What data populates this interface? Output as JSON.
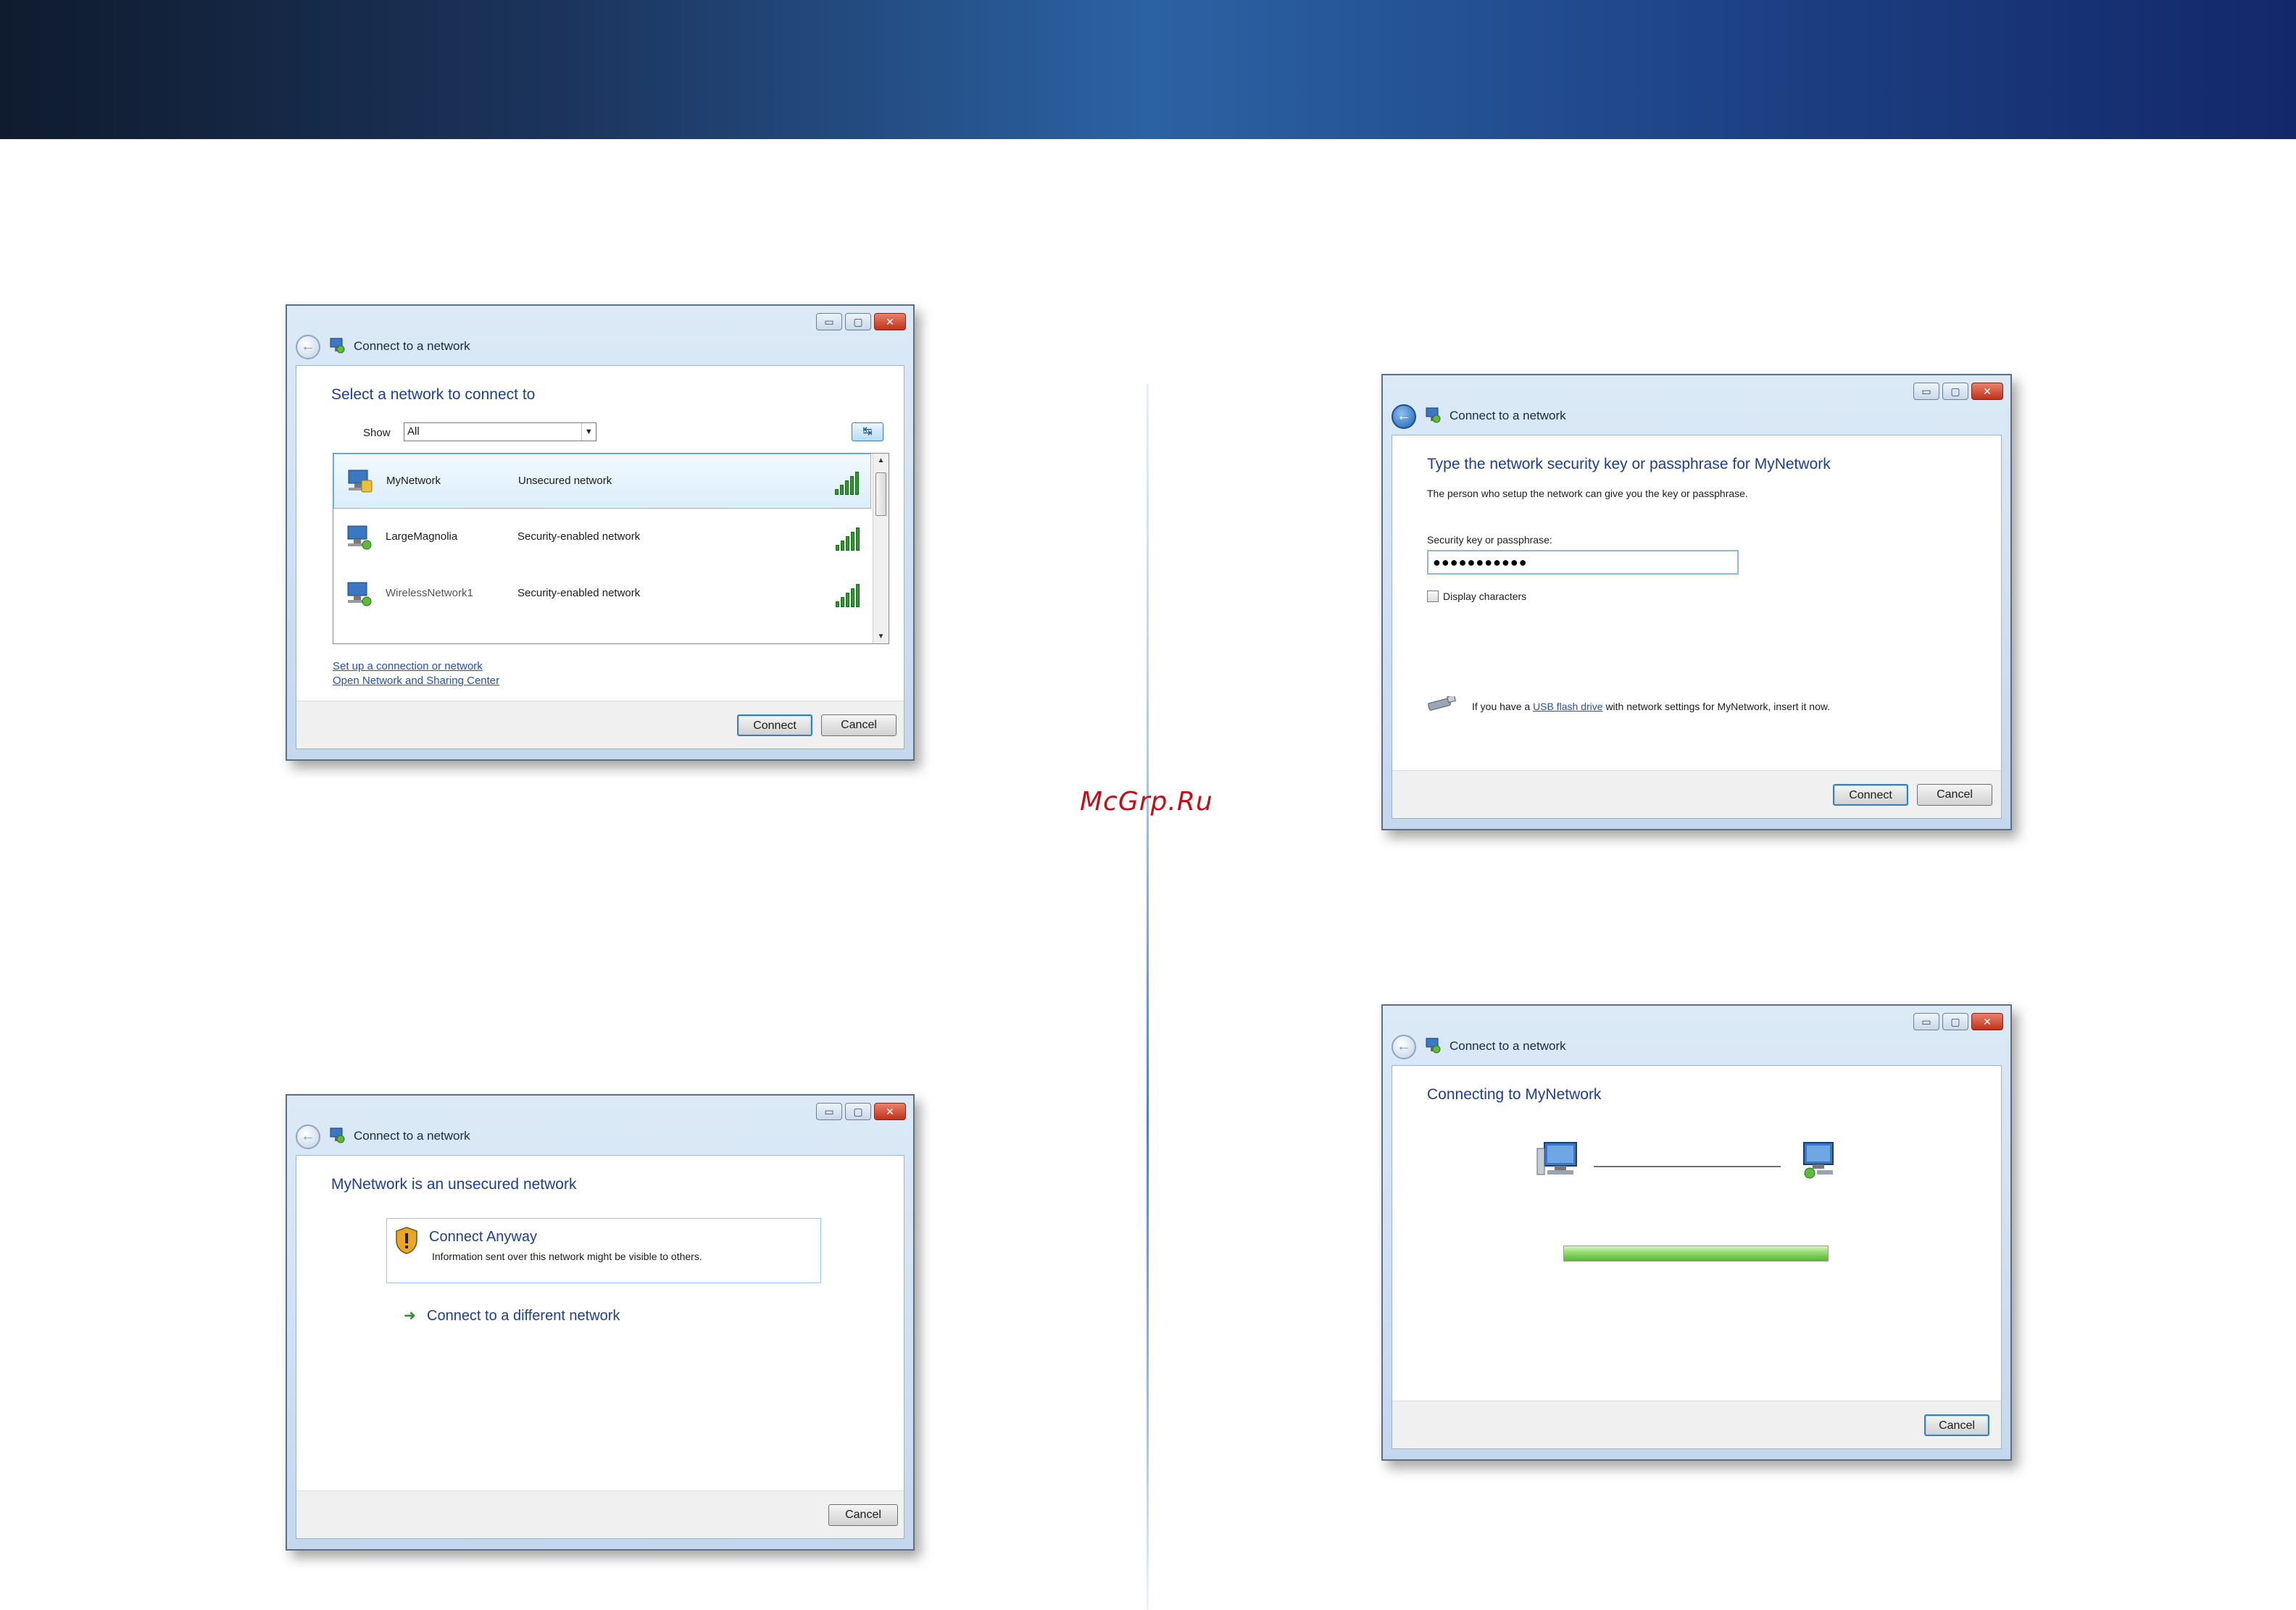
{
  "watermark": "McGrp.Ru",
  "caption_buttons": {
    "minimize": "▭",
    "maximize": "▢",
    "close": "✕"
  },
  "icons": {
    "back": "back-arrow-icon",
    "title_network": "network-icon",
    "refresh": "refresh-icon",
    "network": "network-connection-icon",
    "signal": "signal-strength-icon",
    "usb": "usb-drive-icon",
    "shield": "security-shield-icon",
    "arrow": "green-arrow-icon",
    "computer": "computer-icon"
  },
  "colors": {
    "heading": "#1e3e8f",
    "link": "#2450b0",
    "signal": "#2e9a2e",
    "watermark": "#c0101a"
  },
  "window_select": {
    "title": "Connect to a network",
    "heading": "Select a network to connect to",
    "show_label": "Show",
    "show_value": "All",
    "refresh_glyph": "↹",
    "networks": [
      {
        "name": "MyNetwork",
        "security": "Unsecured network",
        "selected": true,
        "signal": 5
      },
      {
        "name": "LargeMagnolia",
        "security": "Security-enabled network",
        "selected": false,
        "signal": 5
      },
      {
        "name": "WirelessNetwork1",
        "security": "Security-enabled network",
        "selected": false,
        "signal": 5
      }
    ],
    "links": [
      "Set up a connection or network",
      "Open Network and Sharing Center"
    ],
    "connect_label": "Connect",
    "cancel_label": "Cancel"
  },
  "window_key": {
    "title": "Connect to a network",
    "heading": "Type the network security key or passphrase for MyNetwork",
    "subtext": "The person who setup the network can give you the key or passphrase.",
    "field_label": "Security key or passphrase:",
    "field_value": "●●●●●●●●●●●",
    "display_chars_label": "Display characters",
    "display_chars_checked": false,
    "usb_text_before": "If you have a",
    "usb_link": "USB flash drive",
    "usb_text_after": "with network settings for MyNetwork, insert it now.",
    "connect_label": "Connect",
    "cancel_label": "Cancel"
  },
  "window_unsecured": {
    "title": "Connect to a network",
    "heading": "MyNetwork is an unsecured network",
    "option_title": "Connect Anyway",
    "option_desc": "Information sent over this network might be visible to others.",
    "alt_option": "Connect to a different network",
    "cancel_label": "Cancel"
  },
  "window_connecting": {
    "title": "Connect to a network",
    "heading": "Connecting to MyNetwork",
    "progress": 1.0,
    "cancel_label": "Cancel"
  }
}
